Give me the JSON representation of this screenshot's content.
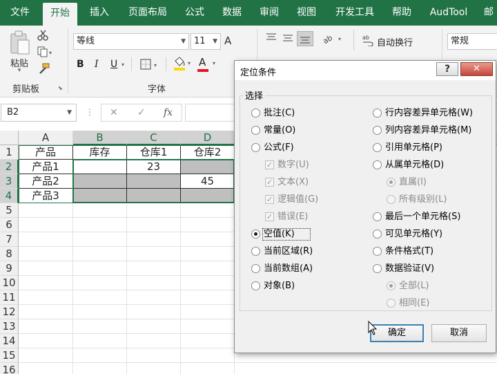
{
  "ribbon_tabs": [
    "文件",
    "开始",
    "插入",
    "页面布局",
    "公式",
    "数据",
    "审阅",
    "视图",
    "开发工具",
    "帮助",
    "AudTool",
    "邮"
  ],
  "clipboard": {
    "paste_label": "粘贴",
    "group_label": "剪贴板"
  },
  "font": {
    "name": "等线",
    "size": "11",
    "group_label": "字体",
    "bold": "B",
    "italic": "I",
    "underline": "U",
    "font_color_letter": "A",
    "grow_font": "A",
    "highlight_color": "#ffd800",
    "font_color": "#e81123"
  },
  "alignment": {
    "wrap_text_label": "自动换行"
  },
  "number": {
    "format": "常规"
  },
  "formula_bar": {
    "name_box": "B2",
    "cancel": "✕",
    "enter": "✓",
    "function": "fx"
  },
  "sheet": {
    "columns": [
      "A",
      "B",
      "C",
      "D"
    ],
    "rows": [
      "1",
      "2",
      "3",
      "4",
      "5",
      "6",
      "7",
      "8",
      "9",
      "10",
      "11",
      "12",
      "13",
      "14",
      "15",
      "16"
    ],
    "cells": {
      "A1": "产品",
      "B1": "库存",
      "C1": "仓库1",
      "D1": "仓库2",
      "A2": "产品1",
      "A3": "产品2",
      "A4": "产品3",
      "C2": "23",
      "D3": "45"
    }
  },
  "dialog": {
    "title": "定位条件",
    "help": "?",
    "close": "✕",
    "section_label": "选择",
    "left_options": [
      {
        "label": "批注(C)",
        "state": "enabled"
      },
      {
        "label": "常量(O)",
        "state": "enabled"
      },
      {
        "label": "公式(F)",
        "state": "enabled"
      },
      {
        "label": "数字(U)",
        "state": "disabled-checked"
      },
      {
        "label": "文本(X)",
        "state": "disabled-checked"
      },
      {
        "label": "逻辑值(G)",
        "state": "disabled-checked"
      },
      {
        "label": "错误(E)",
        "state": "disabled-checked"
      },
      {
        "label": "空值(K)",
        "state": "selected"
      },
      {
        "label": "当前区域(R)",
        "state": "enabled"
      },
      {
        "label": "当前数组(A)",
        "state": "enabled"
      },
      {
        "label": "对象(B)",
        "state": "enabled"
      }
    ],
    "right_options": [
      {
        "label": "行内容差异单元格(W)",
        "state": "enabled"
      },
      {
        "label": "列内容差异单元格(M)",
        "state": "enabled"
      },
      {
        "label": "引用单元格(P)",
        "state": "enabled"
      },
      {
        "label": "从属单元格(D)",
        "state": "enabled"
      },
      {
        "label": "直属(I)",
        "state": "disabled-selected"
      },
      {
        "label": "所有级别(L)",
        "state": "disabled"
      },
      {
        "label": "最后一个单元格(S)",
        "state": "enabled"
      },
      {
        "label": "可见单元格(Y)",
        "state": "enabled"
      },
      {
        "label": "条件格式(T)",
        "state": "enabled"
      },
      {
        "label": "数据验证(V)",
        "state": "enabled"
      },
      {
        "label": "全部(L)",
        "state": "disabled-selected"
      },
      {
        "label": "相同(E)",
        "state": "disabled"
      }
    ],
    "ok_label": "确定",
    "cancel_label": "取消"
  },
  "colors": {
    "ribbon_green": "#217346",
    "selection_gray": "#bfbfbf",
    "dialog_bg": "#f0f0f0",
    "close_red": "#c5463a"
  }
}
